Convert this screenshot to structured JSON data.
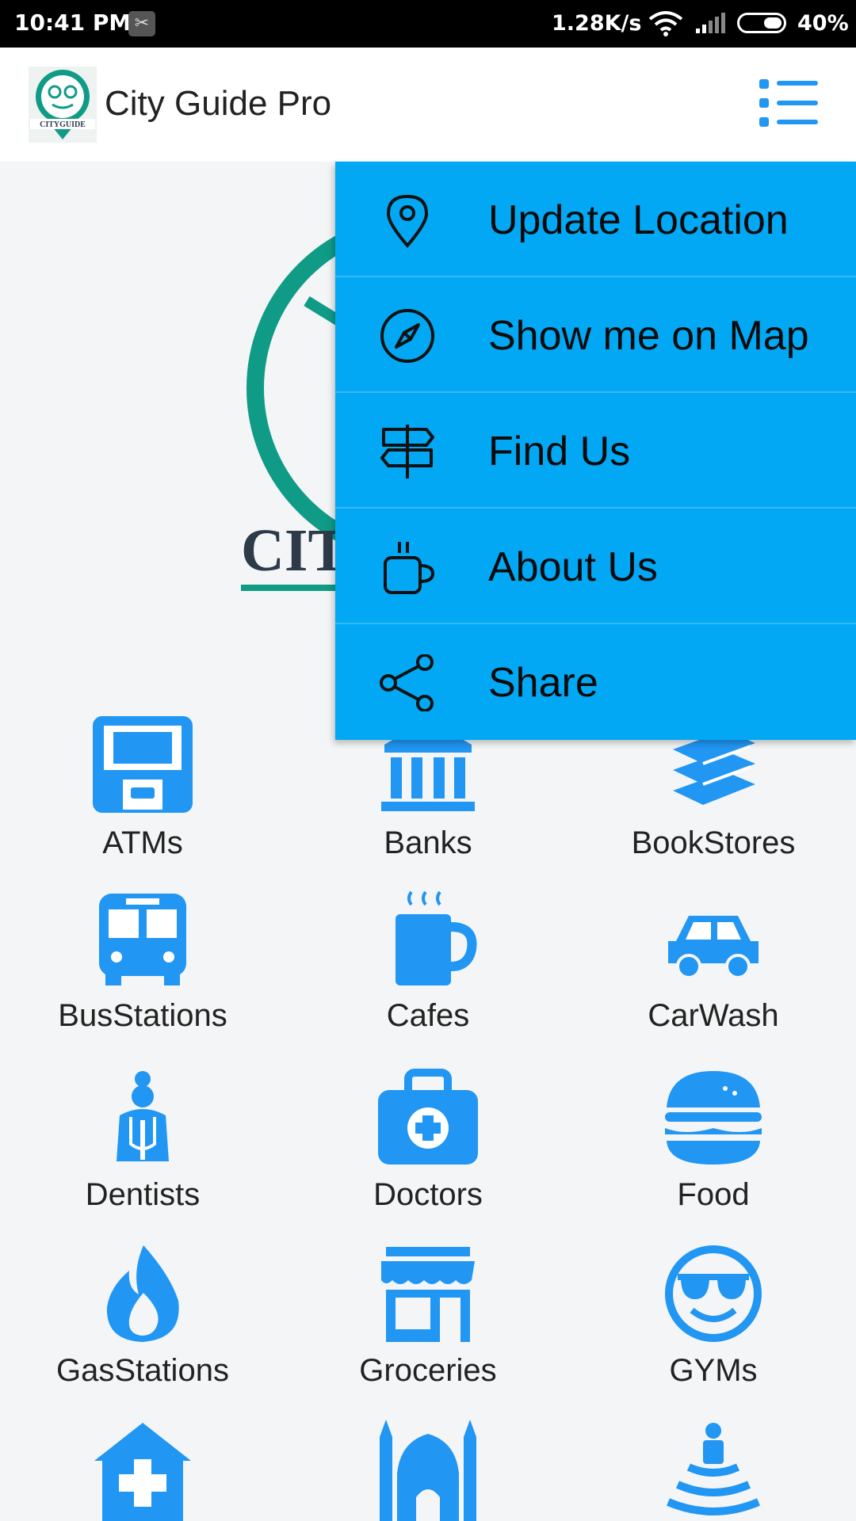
{
  "status_bar": {
    "time": "10:41 PM",
    "net_speed": "1.28K/s",
    "battery_pct": "40%"
  },
  "app_bar": {
    "title": "City Guide Pro",
    "logo_text": "CITYGUIDE",
    "menu_icon": "list-menu-icon"
  },
  "background_logo": {
    "visible_text": "CIT"
  },
  "dropdown_menu": {
    "items": [
      {
        "label": "Update Location",
        "icon": "map-pin-icon"
      },
      {
        "label": "Show me on Map",
        "icon": "compass-icon"
      },
      {
        "label": "Find Us",
        "icon": "signpost-icon"
      },
      {
        "label": "About Us",
        "icon": "coffee-cup-icon"
      },
      {
        "label": "Share",
        "icon": "share-icon"
      }
    ]
  },
  "categories": [
    {
      "label": "ATMs",
      "icon": "atm-icon"
    },
    {
      "label": "Banks",
      "icon": "bank-icon"
    },
    {
      "label": "BookStores",
      "icon": "books-icon"
    },
    {
      "label": "BusStations",
      "icon": "bus-icon"
    },
    {
      "label": "Cafes",
      "icon": "cafe-icon"
    },
    {
      "label": "CarWash",
      "icon": "car-icon"
    },
    {
      "label": "Dentists",
      "icon": "dentist-icon"
    },
    {
      "label": "Doctors",
      "icon": "medical-kit-icon"
    },
    {
      "label": "Food",
      "icon": "burger-icon"
    },
    {
      "label": "GasStations",
      "icon": "flame-icon"
    },
    {
      "label": "Groceries",
      "icon": "store-icon"
    },
    {
      "label": "GYMs",
      "icon": "smiley-sunglasses-icon"
    },
    {
      "label": "",
      "icon": "hospital-icon"
    },
    {
      "label": "",
      "icon": "mosque-icon"
    },
    {
      "label": "",
      "icon": "fountain-icon"
    }
  ],
  "colors": {
    "accent": "#2196f3",
    "menu_bg": "#02a8f4",
    "logo_green": "#0f9b86",
    "logo_dark": "#2c3a4a"
  }
}
